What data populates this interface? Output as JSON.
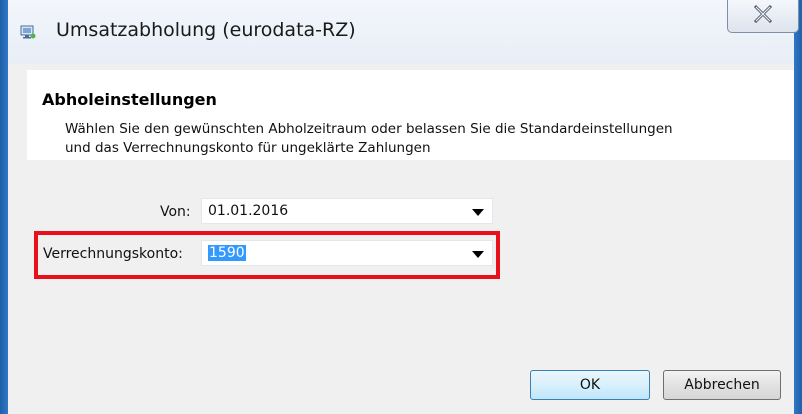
{
  "window": {
    "title": "Umsatzabholung (eurodata-RZ)",
    "close_symbol": "X",
    "icon": "app-icon"
  },
  "header": {
    "title": "Abholeinstellungen",
    "description_line1": "Wählen Sie den gewünschten Abholzeitraum oder belassen Sie die Standardeinstellungen",
    "description_line2": "und das Verrechnungskonto für ungeklärte Zahlungen"
  },
  "form": {
    "von_label": "Von:",
    "von_value": "01.01.2016",
    "konto_label": "Verrechnungskonto:",
    "konto_value": "1590"
  },
  "buttons": {
    "ok_label": "OK",
    "cancel_label": "Abbrechen"
  },
  "colors": {
    "highlight": "#e8101a",
    "selection": "#3399ff",
    "window_border": "#2f78c8"
  }
}
